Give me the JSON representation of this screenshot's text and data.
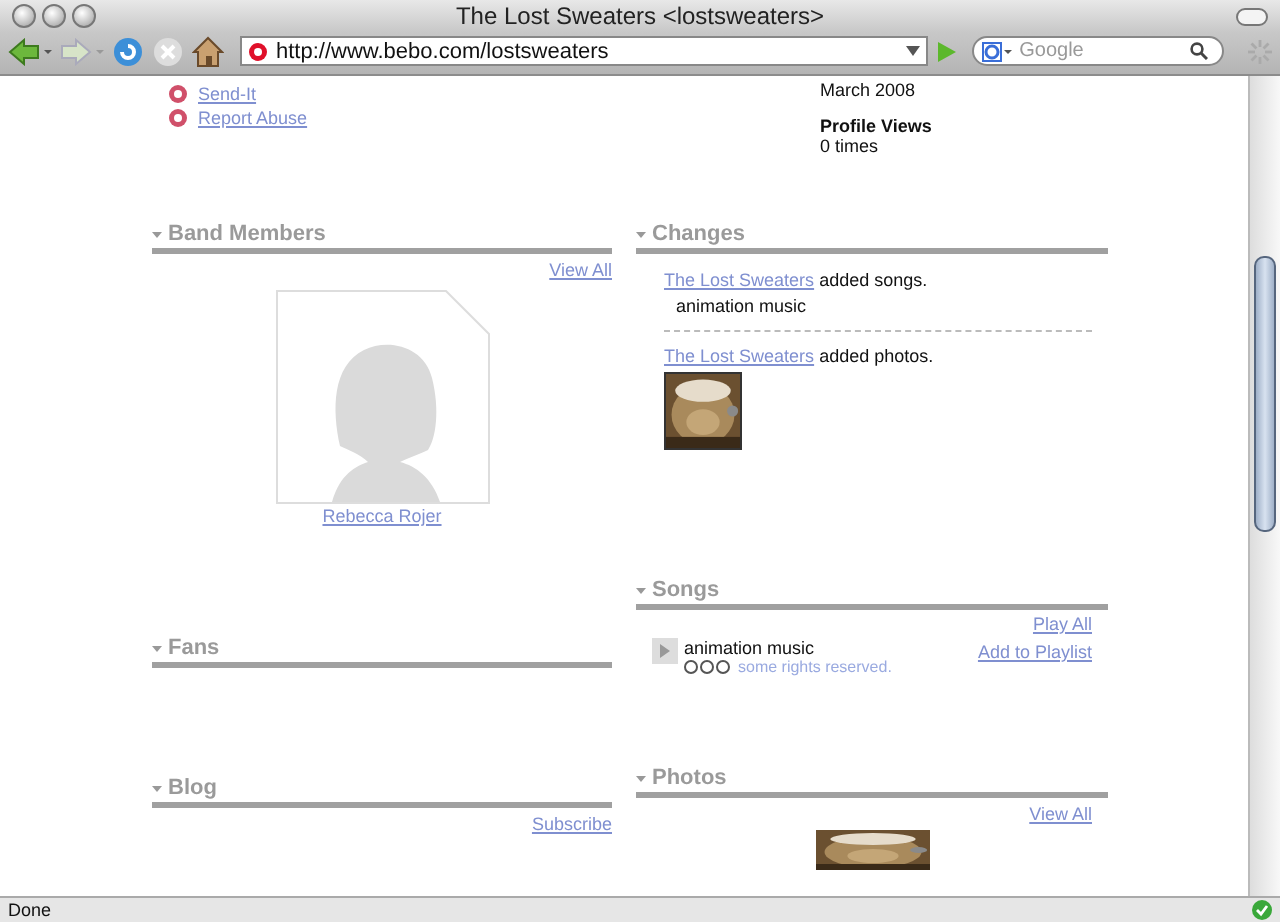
{
  "window": {
    "title": "The Lost Sweaters <lostsweaters>"
  },
  "toolbar": {
    "url": "http://www.bebo.com/lostsweaters",
    "search_placeholder": "Google"
  },
  "profile_links": [
    "Send-It",
    "Report Abuse"
  ],
  "profile_info": [
    {
      "value": "March 2008"
    },
    {
      "label": "Profile Views",
      "value": "0 times"
    }
  ],
  "left_sections": [
    {
      "title": "Band Members",
      "link": "View All",
      "members": [
        "Rebecca Rojer"
      ]
    },
    {
      "title": "Fans"
    },
    {
      "title": "Blog",
      "link": "Subscribe"
    }
  ],
  "right_sections": [
    {
      "title": "Changes",
      "changes": [
        {
          "kind": "text",
          "actor": "The Lost Sweaters",
          "action": "added songs.",
          "detail": "animation music"
        },
        {
          "actor": "The Lost Sweaters",
          "action": "added photos."
        }
      ]
    },
    {
      "title": "Songs",
      "links": [
        "Play All",
        "Add to Playlist"
      ],
      "songs": [
        {
          "title": "animation music",
          "license": "some rights reserved."
        }
      ]
    },
    {
      "title": "Photos",
      "link": "View All"
    }
  ],
  "status_bar": "Done"
}
